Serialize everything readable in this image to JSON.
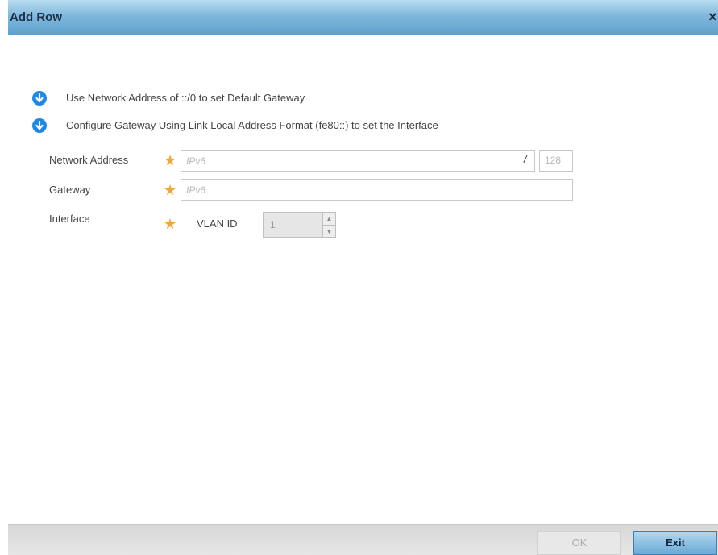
{
  "dialog": {
    "title": "Add Row",
    "close_label": "×"
  },
  "notes": [
    {
      "icon": "arrow-down-circle-icon",
      "text": "Use Network Address of ::/0 to set Default Gateway"
    },
    {
      "icon": "arrow-down-circle-icon",
      "text": "Configure Gateway Using Link Local Address Format (fe80::) to set the Interface"
    }
  ],
  "form": {
    "network_address": {
      "label": "Network Address",
      "placeholder": "IPv6",
      "separator": "/",
      "prefix_placeholder": "128"
    },
    "gateway": {
      "label": "Gateway",
      "placeholder": "IPv6"
    },
    "interface": {
      "label": "Interface",
      "vlan_label": "VLAN ID",
      "vlan_value": "1"
    },
    "required_mark": "★"
  },
  "footer": {
    "ok_label": "OK",
    "exit_label": "Exit"
  },
  "colors": {
    "title_bar": "#7fb8dd",
    "required_star": "#f5a33a",
    "icon_blue": "#1e88e5"
  }
}
